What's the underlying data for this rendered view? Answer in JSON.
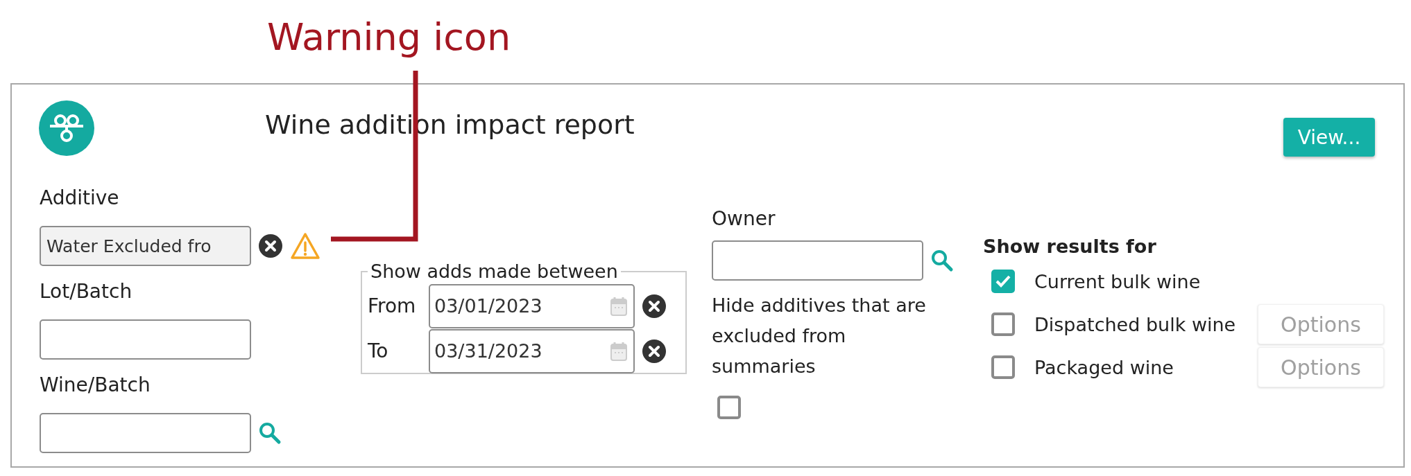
{
  "annotation": {
    "text": "Warning icon"
  },
  "report": {
    "title": "Wine addition impact report",
    "view_button": "View..."
  },
  "additive": {
    "label": "Additive",
    "value": "Water Excluded fro",
    "readonly": true
  },
  "lot_batch": {
    "label": "Lot/Batch"
  },
  "wine_batch": {
    "label": "Wine/Batch"
  },
  "date_range": {
    "legend": "Show adds made between",
    "rows": [
      {
        "label": "From",
        "value": "03/01/2023"
      },
      {
        "label": "To",
        "value": "03/31/2023"
      }
    ]
  },
  "owner": {
    "label": "Owner"
  },
  "hide_excluded": {
    "label": "Hide additives that are excluded from summaries",
    "checked": false
  },
  "show_results": {
    "heading": "Show results for",
    "options": [
      {
        "label": "Current bulk wine",
        "checked": true
      },
      {
        "label": "Dispatched bulk wine",
        "checked": false,
        "options_button": "Options"
      },
      {
        "label": "Packaged wine",
        "checked": false,
        "options_button": "Options"
      }
    ]
  }
}
